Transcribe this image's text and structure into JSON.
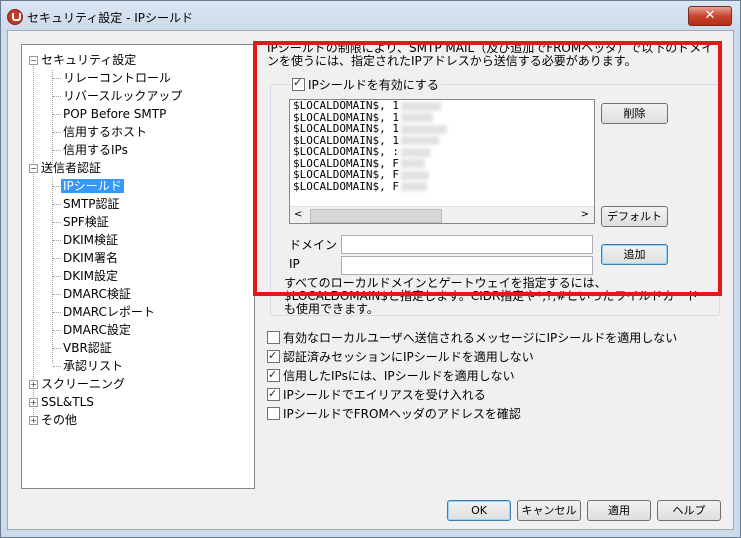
{
  "window": {
    "title": "セキュリティ設定 - IPシールド",
    "close_label": "✕"
  },
  "tree": {
    "security": "セキュリティ設定",
    "security_children": [
      "リレーコントロール",
      "リバースルックアップ",
      "POP Before SMTP",
      "信用するホスト",
      "信用するIPs"
    ],
    "sender_auth": "送信者認証",
    "sender_auth_children": [
      "IPシールド",
      "SMTP認証",
      "SPF検証",
      "DKIM検証",
      "DKIM署名",
      "DKIM設定",
      "DMARC検証",
      "DMARCレポート",
      "DMARC設定",
      "VBR認証",
      "承認リスト"
    ],
    "selected": "IPシールド",
    "others": [
      "スクリーニング",
      "SSL&TLS",
      "その他"
    ]
  },
  "description": "IPシールドの制限により、SMTP MAIL（及び追加でFROMヘッダ）で以下のドメインを使うには、指定されたIPアドレスから送信する必要があります。",
  "ip_shield": {
    "enable_label": "IPシールドを有効にする",
    "enabled": true,
    "entries": [
      "$LOCALDOMAIN$, 1",
      "$LOCALDOMAIN$, 1",
      "$LOCALDOMAIN$, 1",
      "$LOCALDOMAIN$, 1",
      "$LOCALDOMAIN$, :",
      "$LOCALDOMAIN$, F",
      "$LOCALDOMAIN$, F",
      "$LOCALDOMAIN$, F"
    ],
    "delete_label": "削除",
    "default_label": "デフォルト",
    "add_label": "追加",
    "domain_label": "ドメイン",
    "ip_label": "IP",
    "domain_value": "",
    "ip_value": "",
    "note": "すべてのローカルドメインとゲートウェイを指定するには、$LOCALDOMAIN$と指定します。CIDR指定や*,?,#といったワイルドカードも使用できます。"
  },
  "options": [
    {
      "label": "有効なローカルユーザへ送信されるメッセージにIPシールドを適用しない",
      "checked": false
    },
    {
      "label": "認証済みセッションにIPシールドを適用しない",
      "checked": true
    },
    {
      "label": "信用したIPsには、IPシールドを適用しない",
      "checked": true
    },
    {
      "label": "IPシールドでエイリアスを受け入れる",
      "checked": true
    },
    {
      "label": "IPシールドでFROMヘッダのアドレスを確認",
      "checked": false
    }
  ],
  "buttons": {
    "ok": "OK",
    "cancel": "キャンセル",
    "apply": "適用",
    "help": "ヘルプ"
  },
  "colors": {
    "highlight": "#e01a1a",
    "selection": "#3399ff"
  }
}
